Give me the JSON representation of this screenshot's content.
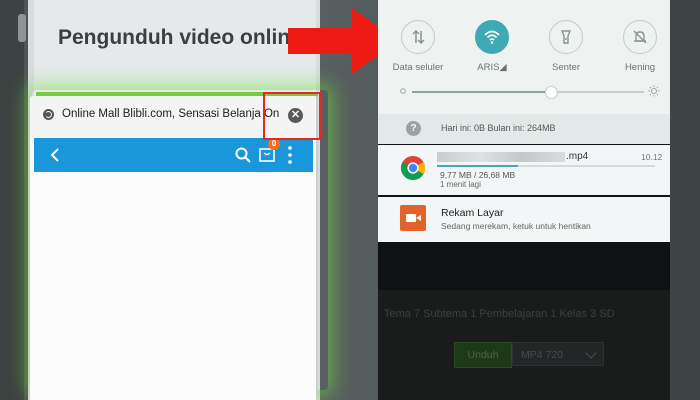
{
  "left_phone": {
    "page_heading": "Pengunduh video online",
    "popup": {
      "url_title": "Online Mall Blibli.com, Sensasi Belanja Online Sh",
      "close_glyph": "✕",
      "cart_badge": "0"
    }
  },
  "right_phone": {
    "quick_settings": [
      {
        "label": "Data seluler",
        "icon": "mobile-data-icon",
        "active": false
      },
      {
        "label": "ARIS◢",
        "icon": "wifi-icon",
        "active": true
      },
      {
        "label": "Senter",
        "icon": "flashlight-icon",
        "active": false
      },
      {
        "label": "Hening",
        "icon": "mute-bell-icon",
        "active": false
      }
    ],
    "brightness_level": 0.6,
    "data_usage": {
      "text": "Hari ini: 0B   Bulan ini: 264MB",
      "icon_glyph": "?"
    },
    "download_notification": {
      "file_extension": ".mp4",
      "time": "10.12",
      "size": "9,77 MB / 26,68 MB",
      "eta": "1 menit lagi",
      "progress": 0.37
    },
    "record_notification": {
      "title": "Rekam Layar",
      "subtitle": "Sedang merekam, ketuk untuk hentikan"
    },
    "background_page": {
      "breadcrumb_text": "Tema 7 Subtema 1 Pembelajaran 1 Kelas 3 SD",
      "download_button": "Unduh",
      "format_select": "MP4  720"
    }
  },
  "colors": {
    "toolbar_blue": "#1a97db",
    "highlight_red": "#e8271f",
    "arrow_red": "#ee1b14",
    "active_teal": "#3fa9b5",
    "record_orange": "#e4622b"
  }
}
